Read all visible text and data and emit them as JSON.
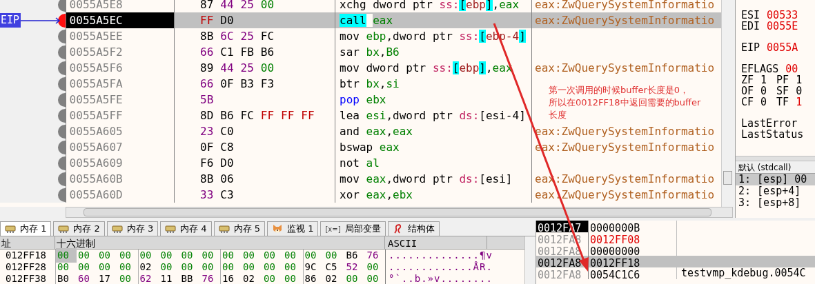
{
  "disassembly": {
    "eip_label": "EIP",
    "rows": [
      {
        "address": "0055A5E8",
        "selected": false,
        "bytes": [
          {
            "text": "87",
            "color": "#000000"
          },
          {
            "text": "44",
            "color": "#800080"
          },
          {
            "text": "25",
            "color": "#800080"
          },
          {
            "text": "00",
            "color": "#008000"
          }
        ],
        "instruction": [
          {
            "text": "xchg",
            "kind": "mnemonic"
          },
          {
            "text": "dword ptr ",
            "kind": "text"
          },
          {
            "text": "ss:",
            "kind": "seg"
          },
          {
            "text": "[",
            "kind": "bracket"
          },
          {
            "text": "ebp",
            "kind": "mem"
          },
          {
            "text": "]",
            "kind": "bracket"
          },
          {
            "text": ",",
            "kind": "text"
          },
          {
            "text": "eax",
            "kind": "reg"
          }
        ],
        "comment": "eax:ZwQuerySystemInformatio"
      },
      {
        "address": "0055A5EC",
        "selected": true,
        "bytes": [
          {
            "text": "FF",
            "color": "#c00000"
          },
          {
            "text": "D0",
            "color": "#000000"
          }
        ],
        "instruction": [
          {
            "text": "call",
            "kind": "call"
          },
          {
            "text": "eax",
            "kind": "reg"
          }
        ],
        "comment": "eax:ZwQuerySystemInformatio"
      },
      {
        "address": "0055A5EE",
        "selected": false,
        "bytes": [
          {
            "text": "8B",
            "color": "#000000"
          },
          {
            "text": "6C",
            "color": "#800080"
          },
          {
            "text": "25",
            "color": "#800080"
          },
          {
            "text": "FC",
            "color": "#000000"
          }
        ],
        "instruction": [
          {
            "text": "mov",
            "kind": "mnemonic"
          },
          {
            "text": "ebp",
            "kind": "reg"
          },
          {
            "text": ",dword ptr ",
            "kind": "text"
          },
          {
            "text": "ss:",
            "kind": "seg"
          },
          {
            "text": "[",
            "kind": "bracket"
          },
          {
            "text": "ebp-4",
            "kind": "mem"
          },
          {
            "text": "]",
            "kind": "bracket"
          }
        ]
      },
      {
        "address": "0055A5F2",
        "selected": false,
        "bytes": [
          {
            "text": "66",
            "color": "#800080"
          },
          {
            "text": "C1",
            "color": "#000000"
          },
          {
            "text": "FB",
            "color": "#000000"
          },
          {
            "text": "B6",
            "color": "#000000"
          }
        ],
        "instruction": [
          {
            "text": "sar",
            "kind": "mnemonic"
          },
          {
            "text": "bx",
            "kind": "reg"
          },
          {
            "text": ",",
            "kind": "text"
          },
          {
            "text": "B6",
            "kind": "reg"
          }
        ]
      },
      {
        "address": "0055A5F6",
        "selected": false,
        "bytes": [
          {
            "text": "89",
            "color": "#000000"
          },
          {
            "text": "44",
            "color": "#800080"
          },
          {
            "text": "25",
            "color": "#800080"
          },
          {
            "text": "00",
            "color": "#008000"
          }
        ],
        "instruction": [
          {
            "text": "mov",
            "kind": "mnemonic"
          },
          {
            "text": "dword ptr ",
            "kind": "text"
          },
          {
            "text": "ss:",
            "kind": "seg"
          },
          {
            "text": "[",
            "kind": "bracket"
          },
          {
            "text": "ebp",
            "kind": "mem"
          },
          {
            "text": "]",
            "kind": "bracket"
          },
          {
            "text": ",",
            "kind": "text"
          },
          {
            "text": "eax",
            "kind": "reg"
          }
        ],
        "comment": "eax:ZwQuerySystemInformatio"
      },
      {
        "address": "0055A5FA",
        "selected": false,
        "bytes": [
          {
            "text": "66",
            "color": "#800080"
          },
          {
            "text": "0F",
            "color": "#000000"
          },
          {
            "text": "B3",
            "color": "#000000"
          },
          {
            "text": "F3",
            "color": "#000000"
          }
        ],
        "instruction": [
          {
            "text": "btr",
            "kind": "mnemonic"
          },
          {
            "text": "bx",
            "kind": "reg"
          },
          {
            "text": ",",
            "kind": "text"
          },
          {
            "text": "si",
            "kind": "reg"
          }
        ]
      },
      {
        "address": "0055A5FE",
        "selected": false,
        "bytes": [
          {
            "text": "5B",
            "color": "#800080"
          }
        ],
        "instruction": [
          {
            "text": "pop",
            "kind": "stack"
          },
          {
            "text": "ebx",
            "kind": "reg"
          }
        ]
      },
      {
        "address": "0055A5FF",
        "selected": false,
        "bytes": [
          {
            "text": "8D",
            "color": "#000000"
          },
          {
            "text": "B6",
            "color": "#000000"
          },
          {
            "text": "FC",
            "color": "#000000"
          },
          {
            "text": "FF",
            "color": "#c00000"
          },
          {
            "text": "FF",
            "color": "#c00000"
          },
          {
            "text": "FF",
            "color": "#c00000"
          }
        ],
        "instruction": [
          {
            "text": "lea",
            "kind": "mnemonic"
          },
          {
            "text": "esi",
            "kind": "reg"
          },
          {
            "text": ",dword ptr ",
            "kind": "text"
          },
          {
            "text": "ds:",
            "kind": "seg"
          },
          {
            "text": "[esi-4]",
            "kind": "text"
          }
        ]
      },
      {
        "address": "0055A605",
        "selected": false,
        "bytes": [
          {
            "text": "23",
            "color": "#800080"
          },
          {
            "text": "C0",
            "color": "#000000"
          }
        ],
        "instruction": [
          {
            "text": "and",
            "kind": "mnemonic"
          },
          {
            "text": "eax",
            "kind": "reg"
          },
          {
            "text": ",",
            "kind": "text"
          },
          {
            "text": "eax",
            "kind": "reg"
          }
        ],
        "comment": "eax:ZwQuerySystemInformatio"
      },
      {
        "address": "0055A607",
        "selected": false,
        "bytes": [
          {
            "text": "0F",
            "color": "#000000"
          },
          {
            "text": "C8",
            "color": "#000000"
          }
        ],
        "instruction": [
          {
            "text": "bswap",
            "kind": "mnemonic"
          },
          {
            "text": "eax",
            "kind": "reg"
          }
        ],
        "comment": "eax:ZwQuerySystemInformatio"
      },
      {
        "address": "0055A609",
        "selected": false,
        "bytes": [
          {
            "text": "F6",
            "color": "#000000"
          },
          {
            "text": "D0",
            "color": "#000000"
          }
        ],
        "instruction": [
          {
            "text": "not",
            "kind": "mnemonic"
          },
          {
            "text": "al",
            "kind": "reg"
          }
        ]
      },
      {
        "address": "0055A60B",
        "selected": false,
        "bytes": [
          {
            "text": "8B",
            "color": "#000000"
          },
          {
            "text": "06",
            "color": "#000000"
          }
        ],
        "instruction": [
          {
            "text": "mov",
            "kind": "mnemonic"
          },
          {
            "text": "eax",
            "kind": "reg"
          },
          {
            "text": ",dword ptr ",
            "kind": "text"
          },
          {
            "text": "ds:",
            "kind": "seg"
          },
          {
            "text": "[esi]",
            "kind": "text"
          }
        ],
        "comment": "eax:ZwQuerySystemInformatio"
      },
      {
        "address": "0055A60D",
        "selected": false,
        "bytes": [
          {
            "text": "33",
            "color": "#800080"
          },
          {
            "text": "C3",
            "color": "#000000"
          }
        ],
        "instruction": [
          {
            "text": "xor",
            "kind": "mnemonic"
          },
          {
            "text": "eax",
            "kind": "reg"
          },
          {
            "text": ",",
            "kind": "text"
          },
          {
            "text": "ebx",
            "kind": "reg"
          }
        ],
        "comment": "eax:ZwQuerySystemInformatio"
      }
    ]
  },
  "annotation": {
    "lines": [
      "第一次调用的时候buffer长度是0，",
      "所以在0012FF18中返回需要的buffer",
      "长度"
    ]
  },
  "registers": {
    "groups": [
      [
        [
          {
            "name": "ESI",
            "value": "00533",
            "changed": true
          }
        ],
        [
          {
            "name": "EDI",
            "value": "0055E",
            "changed": true
          }
        ]
      ],
      [
        [
          {
            "name": "EIP",
            "value": "0055A",
            "changed": true
          }
        ]
      ],
      [
        [
          {
            "name": "EFLAGS",
            "value": "00",
            "changed": true
          }
        ],
        [
          {
            "name": "ZF",
            "value": "1",
            "changed": false
          },
          {
            "name": "PF",
            "value": "1",
            "changed": false
          }
        ],
        [
          {
            "name": "OF",
            "value": "0",
            "changed": false
          },
          {
            "name": "SF",
            "value": "0",
            "changed": false
          }
        ],
        [
          {
            "name": "CF",
            "value": "0",
            "changed": false
          },
          {
            "name": "TF",
            "value": "1",
            "changed": true
          }
        ]
      ],
      [
        [
          {
            "name": "LastError"
          }
        ],
        [
          {
            "name": "LastStatus"
          }
        ]
      ]
    ]
  },
  "call_stack": {
    "convention": "默认 (stdcall)",
    "args": [
      {
        "text": "1: [esp] 00",
        "selected": true
      },
      {
        "text": "2: [esp+4]",
        "selected": false
      },
      {
        "text": "3: [esp+8]",
        "selected": false
      }
    ]
  },
  "tabs": [
    {
      "label": "内存 1",
      "kind": "memory",
      "selected": true
    },
    {
      "label": "内存 2",
      "kind": "memory",
      "selected": false
    },
    {
      "label": "内存 3",
      "kind": "memory",
      "selected": false
    },
    {
      "label": "内存 4",
      "kind": "memory",
      "selected": false
    },
    {
      "label": "内存 5",
      "kind": "memory",
      "selected": false
    },
    {
      "label": "监视 1",
      "kind": "watch",
      "selected": false
    },
    {
      "label": "局部变量",
      "kind": "locals",
      "icon_text": "[x=]",
      "selected": false
    },
    {
      "label": "结构体",
      "kind": "struct",
      "selected": false
    }
  ],
  "dump": {
    "columns": [
      "址",
      "十六进制",
      "ASCII"
    ],
    "rows": [
      {
        "address": "012FF18",
        "bytes": [
          {
            "text": "00",
            "color": "#008000"
          },
          {
            "text": "00",
            "color": "#008000"
          },
          {
            "text": "00",
            "color": "#008000"
          },
          {
            "text": "00",
            "color": "#008000"
          },
          {
            "text": "00",
            "color": "#008000"
          },
          {
            "text": "00",
            "color": "#008000"
          },
          {
            "text": "00",
            "color": "#008000"
          },
          {
            "text": "00",
            "color": "#008000"
          },
          {
            "text": "00",
            "color": "#008000"
          },
          {
            "text": "00",
            "color": "#008000"
          },
          {
            "text": "00",
            "color": "#008000"
          },
          {
            "text": "00",
            "color": "#008000"
          },
          {
            "text": "00",
            "color": "#008000"
          },
          {
            "text": "00",
            "color": "#008000"
          },
          {
            "text": "B6",
            "color": "#000000"
          },
          {
            "text": "76",
            "color": "#800080"
          }
        ],
        "ascii": "..............¶v"
      },
      {
        "address": "012FF28",
        "bytes": [
          {
            "text": "00",
            "color": "#008000"
          },
          {
            "text": "00",
            "color": "#008000"
          },
          {
            "text": "00",
            "color": "#008000"
          },
          {
            "text": "00",
            "color": "#008000"
          },
          {
            "text": "02",
            "color": "#000000"
          },
          {
            "text": "00",
            "color": "#008000"
          },
          {
            "text": "00",
            "color": "#008000"
          },
          {
            "text": "00",
            "color": "#008000"
          },
          {
            "text": "00",
            "color": "#008000"
          },
          {
            "text": "00",
            "color": "#008000"
          },
          {
            "text": "00",
            "color": "#008000"
          },
          {
            "text": "00",
            "color": "#008000"
          },
          {
            "text": "9C",
            "color": "#000000"
          },
          {
            "text": "C5",
            "color": "#000000"
          },
          {
            "text": "52",
            "color": "#800080"
          },
          {
            "text": "00",
            "color": "#008000"
          }
        ],
        "ascii": ".............ÅR."
      },
      {
        "address": "012FF38",
        "bytes": [
          {
            "text": "B0",
            "color": "#000000"
          },
          {
            "text": "60",
            "color": "#800080"
          },
          {
            "text": "17",
            "color": "#000000"
          },
          {
            "text": "00",
            "color": "#008000"
          },
          {
            "text": "62",
            "color": "#800080"
          },
          {
            "text": "11",
            "color": "#000000"
          },
          {
            "text": "BB",
            "color": "#000000"
          },
          {
            "text": "76",
            "color": "#800080"
          },
          {
            "text": "16",
            "color": "#000000"
          },
          {
            "text": "02",
            "color": "#000000"
          },
          {
            "text": "00",
            "color": "#008000"
          },
          {
            "text": "00",
            "color": "#008000"
          },
          {
            "text": "86",
            "color": "#000000"
          },
          {
            "text": "02",
            "color": "#000000"
          },
          {
            "text": "00",
            "color": "#008000"
          },
          {
            "text": "00",
            "color": "#008000"
          }
        ],
        "ascii": "°`..b.»v........"
      }
    ]
  },
  "stack": {
    "rows": [
      {
        "address": "0012FA7",
        "value": "0000000B",
        "changed": false,
        "selected": true,
        "highlighted": false
      },
      {
        "address": "0012FA8",
        "value": "0012FF08",
        "changed": true,
        "selected": false,
        "highlighted": false
      },
      {
        "address": "0012FA8",
        "value": "00000000",
        "changed": false,
        "selected": false,
        "highlighted": false
      },
      {
        "address": "0012FA8",
        "value": "0012FF18",
        "changed": false,
        "selected": false,
        "highlighted": true
      },
      {
        "address": "0012FA8",
        "value": "0054C1C6",
        "comment": "testvmp_kdebug.0054C",
        "changed": false,
        "selected": false,
        "highlighted": false
      }
    ]
  }
}
